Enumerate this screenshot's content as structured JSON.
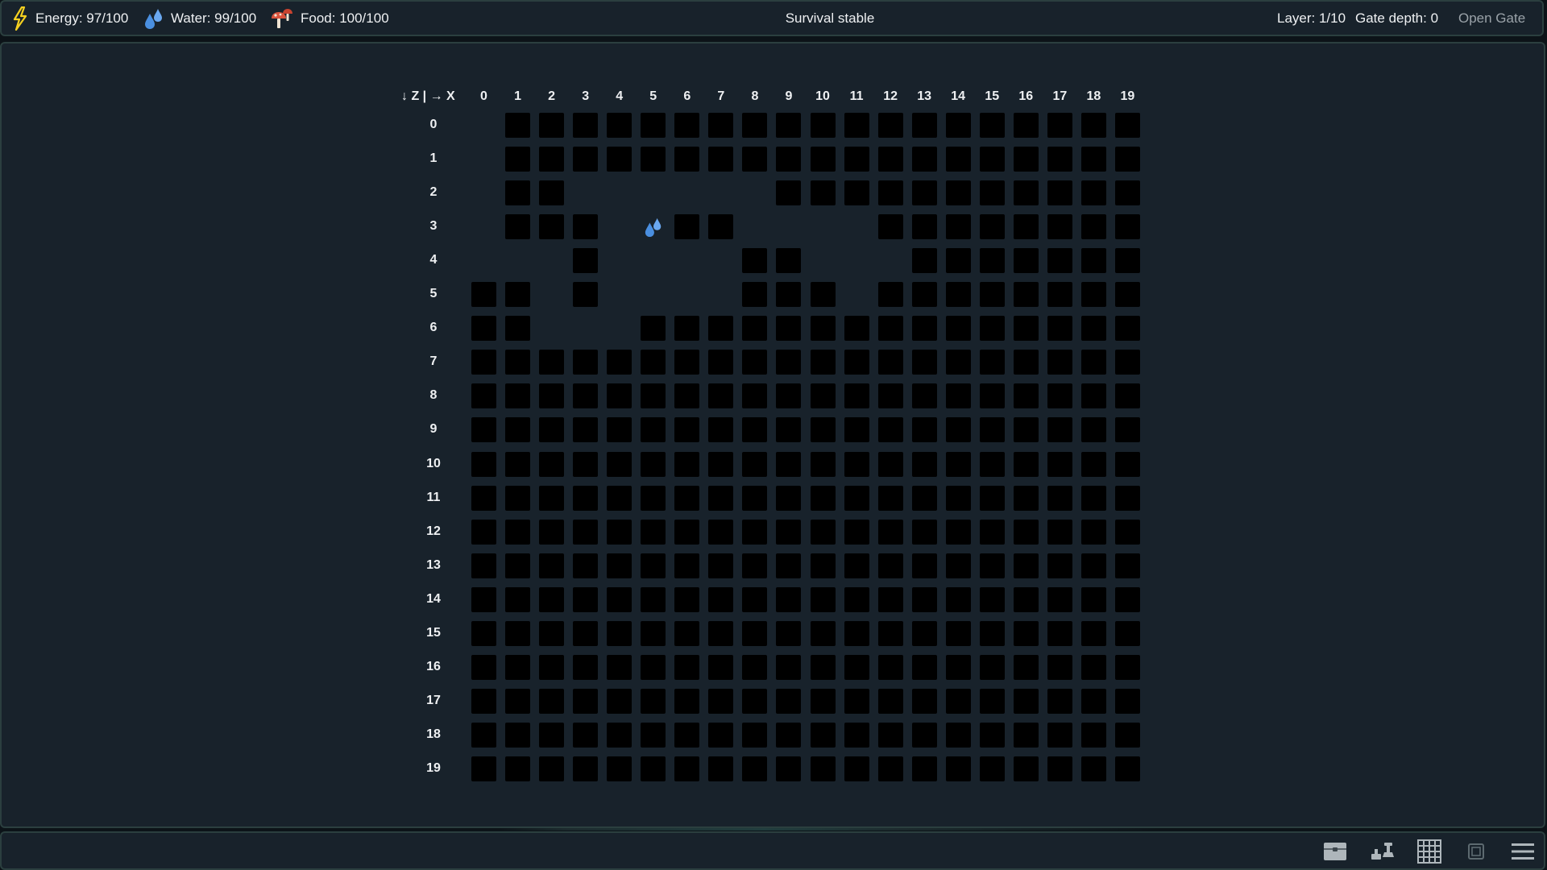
{
  "topbar": {
    "energy_label": "Energy: 97/100",
    "water_label": "Water: 99/100",
    "food_label": "Food: 100/100",
    "status": "Survival stable",
    "layer_label": "Layer: 1/10",
    "gate_depth_label": "Gate depth: 0",
    "open_gate": "Open Gate"
  },
  "icons": {
    "energy": "lightning-icon",
    "water": "water-drops-icon",
    "food": "mushroom-icon"
  },
  "colors": {
    "energy": "#f5d020",
    "water": "#4a8fe0",
    "food": "#d9533d",
    "cell": "#000000",
    "panel": "#18222b"
  },
  "grid": {
    "corner_label": "↓ Z | → X",
    "x_labels": [
      "0",
      "1",
      "2",
      "3",
      "4",
      "5",
      "6",
      "7",
      "8",
      "9",
      "10",
      "11",
      "12",
      "13",
      "14",
      "15",
      "16",
      "17",
      "18",
      "19"
    ],
    "z_labels": [
      "0",
      "1",
      "2",
      "3",
      "4",
      "5",
      "6",
      "7",
      "8",
      "9",
      "10",
      "11",
      "12",
      "13",
      "14",
      "15",
      "16",
      "17",
      "18",
      "19"
    ],
    "rows": [
      "-###################",
      "-###################",
      "-##------###########",
      "-###-W##----########",
      "---#----##---#######",
      "##-#----###-########",
      "##---###############",
      "####################",
      "####################",
      "####################",
      "####################",
      "####################",
      "####################",
      "####################",
      "####################",
      "####################",
      "####################",
      "####################",
      "####################",
      "####################"
    ],
    "legend": {
      "#": "dark tile",
      "-": "empty",
      "W": "water"
    }
  },
  "toolbar": {
    "items": [
      "chest-icon",
      "crafting-icon",
      "grid-icon",
      "book-icon",
      "menu-icon"
    ]
  }
}
